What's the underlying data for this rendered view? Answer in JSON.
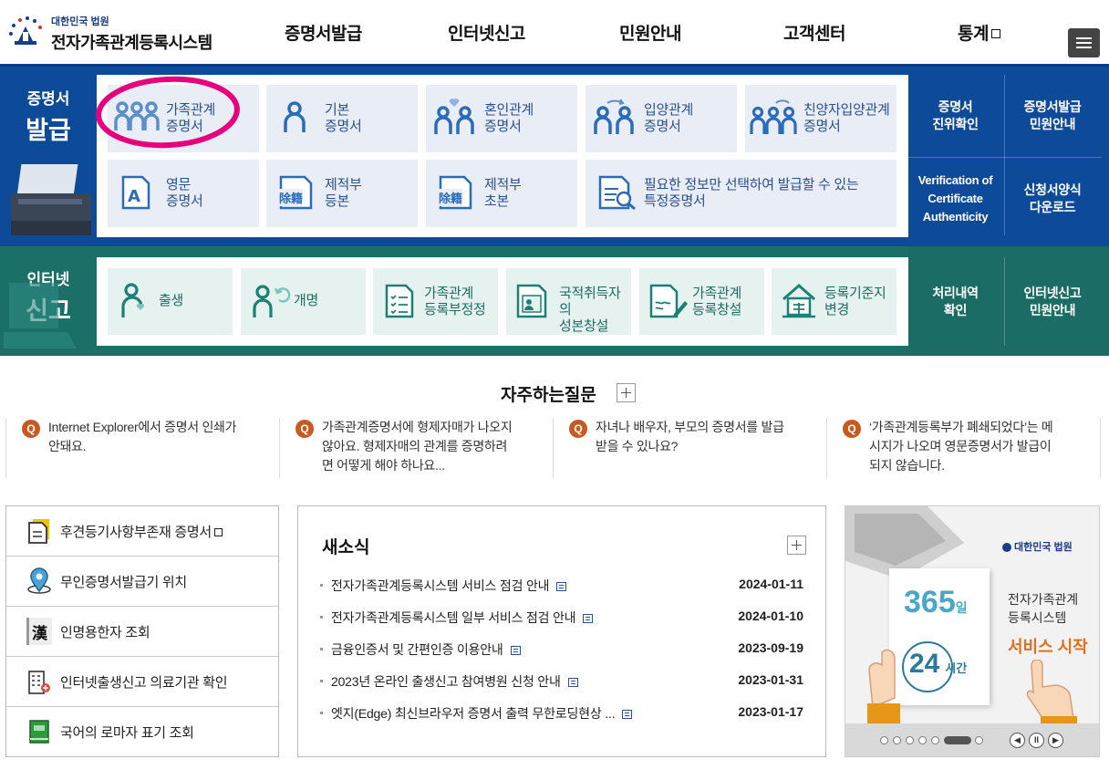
{
  "header": {
    "org": "대한민국 법원",
    "title": "전자가족관계등록시스템",
    "nav": [
      "증명서발급",
      "인터넷신고",
      "민원안내",
      "고객센터",
      "통계"
    ]
  },
  "issue": {
    "label_small": "증명서",
    "label_big": "발급",
    "tiles": [
      {
        "line1": "가족관계",
        "line2": "증명서"
      },
      {
        "line1": "기본",
        "line2": "증명서"
      },
      {
        "line1": "혼인관계",
        "line2": "증명서"
      },
      {
        "line1": "입양관계",
        "line2": "증명서"
      },
      {
        "line1": "친양자입양관계",
        "line2": "증명서"
      },
      {
        "line1": "영문",
        "line2": "증명서"
      },
      {
        "line1": "제적부",
        "line2": "등본"
      },
      {
        "line1": "제적부",
        "line2": "초본"
      },
      {
        "line1": "필요한 정보만 선택하여 발급할 수 있는",
        "line2": "특정증명서"
      }
    ],
    "side": [
      {
        "line1": "증명서",
        "line2": "진위확인",
        "line3": ""
      },
      {
        "line1": "증명서발급",
        "line2": "민원안내",
        "line3": ""
      },
      {
        "line1": "Verification of",
        "line2": "Certificate",
        "line3": "Authenticity"
      },
      {
        "line1": "신청서양식",
        "line2": "다운로드",
        "line3": ""
      }
    ],
    "seal_text": "除籍"
  },
  "report": {
    "label_small": "인터넷",
    "label_big": "신고",
    "tiles": [
      {
        "line1": "출생",
        "line2": ""
      },
      {
        "line1": "개명",
        "line2": ""
      },
      {
        "line1": "가족관계",
        "line2": "등록부정정"
      },
      {
        "line1": "국적취득자의",
        "line2": "성본창설"
      },
      {
        "line1": "가족관계",
        "line2": "등록창설"
      },
      {
        "line1": "등록기준지",
        "line2": "변경"
      }
    ],
    "side": [
      {
        "line1": "처리내역",
        "line2": "확인"
      },
      {
        "line1": "인터넷신고",
        "line2": "민원안내"
      }
    ]
  },
  "faq": {
    "title": "자주하는질문",
    "q_mark": "Q",
    "items": [
      {
        "line1": "Internet Explorer에서 증명서 인쇄가",
        "line2": "안돼요.",
        "line3": ""
      },
      {
        "line1": "가족관계증명서에 형제자매가 나오지",
        "line2": "않아요. 형제자매의 관계를 증명하려",
        "line3": "면 어떻게 해야 하나요..."
      },
      {
        "line1": "자녀나 배우자, 부모의 증명서를 발급",
        "line2": "받을 수 있나요?",
        "line3": ""
      },
      {
        "line1": "‘가족관계등록부가 폐쇄되었다’는 메",
        "line2": "시지가 나오며 영문증명서가 발급이",
        "line3": "되지 않습니다."
      }
    ]
  },
  "quick": [
    {
      "label": "후견등기사항부존재 증명서"
    },
    {
      "label": "무인증명서발급기 위치"
    },
    {
      "label": "인명용한자 조회"
    },
    {
      "label": "인터넷출생신고 의료기관 확인"
    },
    {
      "label": "국어의 로마자 표기 조회"
    }
  ],
  "quick_hanja": "漢",
  "news": {
    "title": "새소식",
    "items": [
      {
        "title": "전자가족관계등록시스템 서비스 점검 안내",
        "date": "2024-01-11"
      },
      {
        "title": "전자가족관계등록시스템 일부 서비스 점검 안내",
        "date": "2024-01-10"
      },
      {
        "title": "금융인증서 및 간편인증 이용안내",
        "date": "2023-09-19"
      },
      {
        "title": "2023년 온라인 출생신고 참여병원 신청 안내",
        "date": "2023-01-31"
      },
      {
        "title": "엣지(Edge) 최신브라우저 증명서 출력 무한로딩현상 ...",
        "date": "2023-01-17"
      }
    ]
  },
  "banner": {
    "org": "대한민국 법원",
    "num365": "365",
    "unit_day": "일",
    "num24": "24",
    "unit_hour": "시간",
    "line1": "전자가족관계",
    "line2": "등록시스템",
    "cta": "서비스 시작",
    "pause": "II"
  },
  "colors": {
    "issue_band": "#0e4a9a",
    "report_band": "#1a6f66",
    "highlight_circle": "#e6007e",
    "faq_q": "#c85a1f"
  }
}
